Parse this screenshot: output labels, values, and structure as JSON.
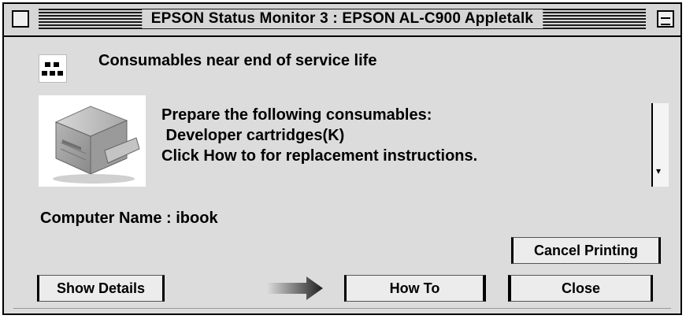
{
  "window": {
    "title": "EPSON Status Monitor 3 : EPSON AL-C900 Appletalk"
  },
  "header": {
    "title": "Consumables near end of service life"
  },
  "message": {
    "lines": [
      "Prepare the following consumables:",
      " Developer cartridges(K)",
      "Click How to for replacement instructions."
    ]
  },
  "computer": {
    "label": "Computer Name : ibook"
  },
  "buttons": {
    "cancel_printing": "Cancel Printing",
    "show_details": "Show Details",
    "how_to": "How To",
    "close": "Close"
  },
  "scrollbar": {
    "arrow_glyph": "▾"
  },
  "colors": {
    "window_bg": "#dcdcdc",
    "titlebar_stripes": "#1a1a1a",
    "arrow_gradient_start": "#dcdcdc",
    "arrow_gradient_end": "#202020"
  },
  "icons": [
    "close-box-icon",
    "zoom-box-icon",
    "printer-status-icon",
    "printer-image",
    "arrow-right-icon"
  ]
}
